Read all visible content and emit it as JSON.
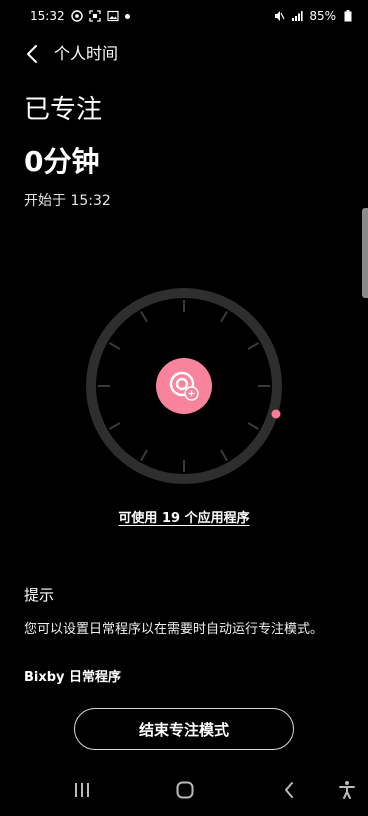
{
  "status_bar": {
    "time": "15:32",
    "battery_percent": "85%",
    "icons_left": [
      "focus-mode-icon",
      "screenshot-icon",
      "image-icon",
      "notification-dot-icon"
    ],
    "icons_right": [
      "mute-icon",
      "signal-icon",
      "battery-icon"
    ]
  },
  "header": {
    "title": "个人时间"
  },
  "focus": {
    "status": "已专注",
    "duration": "0分钟",
    "start_text": "开始于 15:32"
  },
  "dial": {
    "center_icon": "focus-timer-icon",
    "indicator_color": "#ff7a9a",
    "ring_color": "#2e2e2e",
    "center_color": "#f7849c"
  },
  "apps": {
    "link_label": "可使用 19 个应用程序"
  },
  "tips": {
    "heading": "提示",
    "body": "您可以设置日常程序以在需要时自动运行专注模式。",
    "link": "Bixby 日常程序"
  },
  "end_button": {
    "label": "结束专注模式"
  },
  "nav": {
    "recent_icon": "recent-apps-icon",
    "home_icon": "home-icon",
    "back_icon": "back-icon",
    "accessibility_icon": "accessibility-icon"
  }
}
